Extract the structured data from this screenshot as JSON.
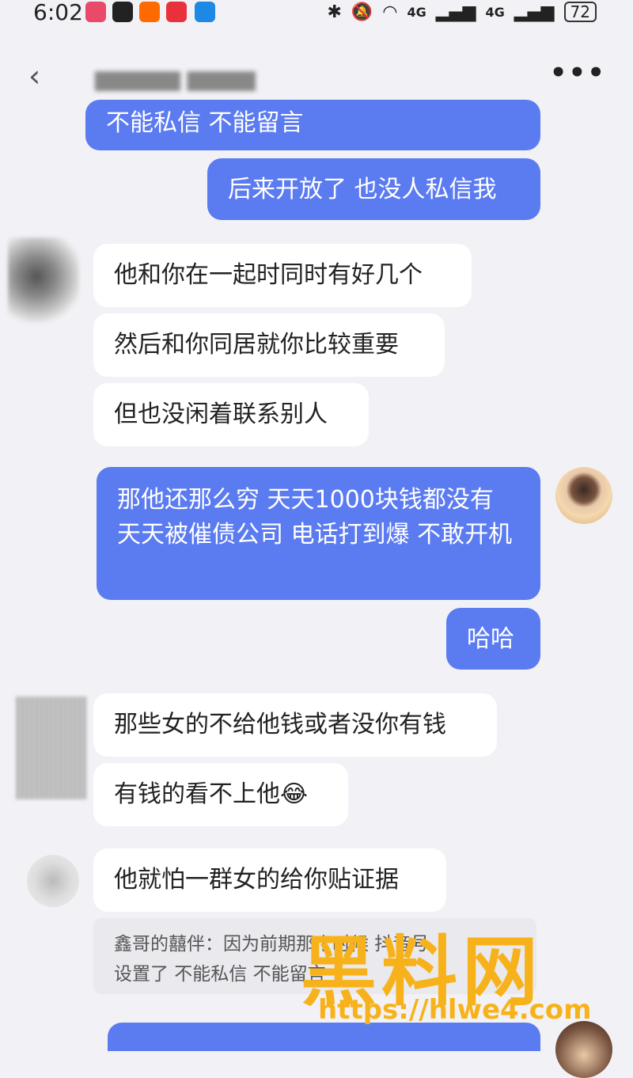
{
  "status_bar": {
    "time": "6:02",
    "battery": "72",
    "network_1": "4G",
    "network_2": "4G"
  },
  "header": {
    "back_icon": "chevron-left-icon",
    "more_icon": "more-dots-icon",
    "more_label": "•••"
  },
  "messages": [
    {
      "id": "m1",
      "side": "out",
      "text": "不能私信 不能留言"
    },
    {
      "id": "m2",
      "side": "out",
      "text": "后来开放了 也没人私信我"
    },
    {
      "id": "m3",
      "side": "in",
      "text": "他和你在一起时同时有好几个"
    },
    {
      "id": "m4",
      "side": "in",
      "text": "然后和你同居就你比较重要"
    },
    {
      "id": "m5",
      "side": "in",
      "text": "但也没闲着联系别人"
    },
    {
      "id": "m6",
      "side": "out",
      "text": "那他还那么穷 天天1000块钱都没有 天天被催债公司 电话打到爆 不敢开机"
    },
    {
      "id": "m7",
      "side": "out",
      "text": "哈哈"
    },
    {
      "id": "m8",
      "side": "in",
      "text": "那些女的不给他钱或者没你有钱"
    },
    {
      "id": "m9",
      "side": "in",
      "text": "有钱的看不上他😂"
    },
    {
      "id": "m10",
      "side": "in",
      "text": "他就怕一群女的给你贴证据"
    }
  ],
  "quote": {
    "line1": "鑫哥的囍伴：因为前期那个时候 抖音号",
    "line2": "设置了 不能私信 不能留言"
  },
  "watermark": {
    "text": "黑料网",
    "url": "https://hlwe4.com"
  },
  "colors": {
    "outgoing_bubble": "#5b7bf0",
    "incoming_bubble": "#ffffff",
    "background": "#f2f2f6",
    "watermark": "#f7b21b"
  }
}
